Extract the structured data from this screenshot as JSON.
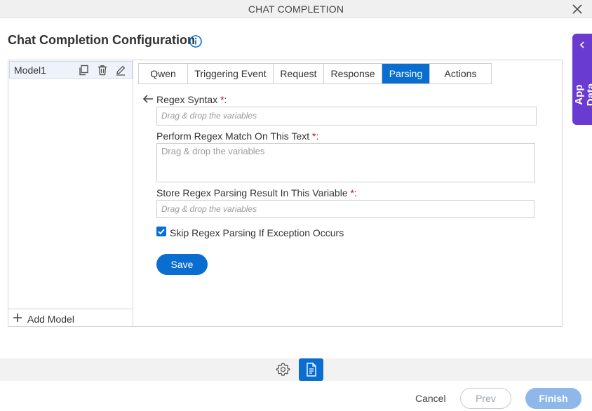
{
  "window": {
    "title": "CHAT COMPLETION"
  },
  "page": {
    "title": "Chat Completion Configuration"
  },
  "models": {
    "items": [
      {
        "label": "Model1"
      }
    ],
    "add_label": "Add Model"
  },
  "tabs": [
    {
      "label": "Qwen"
    },
    {
      "label": "Triggering Event"
    },
    {
      "label": "Request"
    },
    {
      "label": "Response"
    },
    {
      "label": "Parsing"
    },
    {
      "label": "Actions"
    }
  ],
  "active_tab": "Parsing",
  "form": {
    "regex_syntax": {
      "label": "Regex Syntax",
      "required_mark": "*",
      "suffix": ":",
      "placeholder": "Drag & drop the variables"
    },
    "match_text": {
      "label": "Perform Regex Match On This Text",
      "required_mark": "*",
      "suffix": ":",
      "placeholder": "Drag & drop the variables"
    },
    "store_result": {
      "label": "Store Regex Parsing Result In This Variable",
      "required_mark": "*",
      "suffix": ":",
      "placeholder": "Drag & drop the variables"
    },
    "skip_exception": {
      "label": "Skip Regex Parsing If Exception Occurs",
      "checked": true
    },
    "save_label": "Save"
  },
  "side_panel": {
    "label": "App Data"
  },
  "footer": {
    "cancel_label": "Cancel",
    "prev_label": "Prev",
    "finish_label": "Finish"
  },
  "icons": {
    "close": "close-icon",
    "info": "info-icon",
    "duplicate": "duplicate-icon",
    "delete": "trash-icon",
    "edit": "pencil-icon",
    "add": "plus-icon",
    "back": "arrow-left-icon",
    "check": "checkmark-icon",
    "chevron": "chevron-left-icon",
    "settings": "gear-icon",
    "document": "document-icon"
  },
  "colors": {
    "accent": "#0a6ed1",
    "side_panel": "#6a3bd1",
    "required": "#d0021b",
    "finish_disabled": "#8fb8ea"
  }
}
